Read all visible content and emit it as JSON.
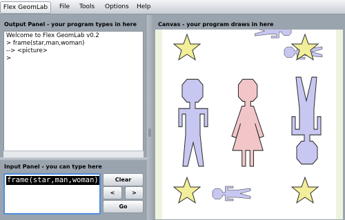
{
  "app": {
    "name": "Flex GeomLab"
  },
  "menu": {
    "items": [
      "File",
      "Tools",
      "Options",
      "Help"
    ]
  },
  "output_panel": {
    "title": "Output Panel - your program types in here",
    "lines": [
      "Welcome to Flex GeomLab v0.2",
      "> frame(star,man,woman)",
      "--> <picture>",
      ">"
    ]
  },
  "canvas_panel": {
    "title": "Canvas - your program draws in here",
    "shapes": [
      "star-icon",
      "man-icon",
      "woman-icon"
    ],
    "colors": {
      "star": "#f2ee99",
      "man": "#c7c7f1",
      "woman": "#f2c6c9",
      "outline": "#2b2b2b",
      "canvas_bg": "#ffffff",
      "canvas_margin": "#eef3df"
    }
  },
  "input_panel": {
    "title": "Input Panel - you can type here",
    "value": "frame(star,man,woman)",
    "buttons": {
      "clear": "Clear",
      "prev": "<",
      "next": ">",
      "go": "Go"
    }
  },
  "colors": {
    "menubar": "#d9dde2",
    "panel_bg": "#9aa4ae",
    "focus_border": "#4d8de0"
  }
}
